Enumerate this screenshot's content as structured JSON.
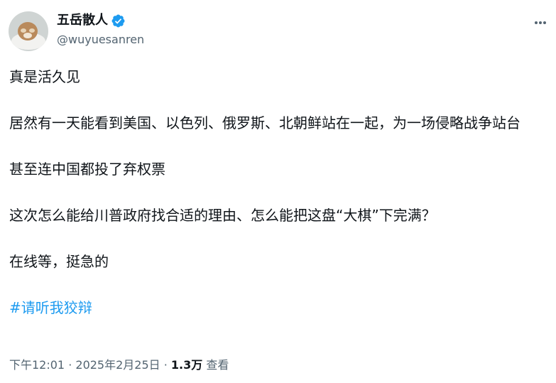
{
  "author": {
    "display_name": "五岳散人",
    "handle": "@wuyuesanren",
    "verified_icon": "verified-badge-icon"
  },
  "tweet": {
    "paragraphs": [
      "真是活久见",
      "居然有一天能看到美国、以色列、俄罗斯、北朝鲜站在一起，为一场侵略战争站台",
      "甚至连中国都投了弃权票",
      "这次怎么能给川普政府找合适的理由、怎么能把这盘“大棋”下完满？",
      "在线等，挺急的"
    ],
    "hashtag": "#请听我狡辩"
  },
  "meta": {
    "time": "下午12:01",
    "sep1": " · ",
    "date": "2025年2月25日",
    "sep2": " · ",
    "views": "1.3万",
    "views_label": " 查看"
  },
  "colors": {
    "accent": "#1d9bf0",
    "muted": "#536471",
    "text": "#0f1419"
  }
}
